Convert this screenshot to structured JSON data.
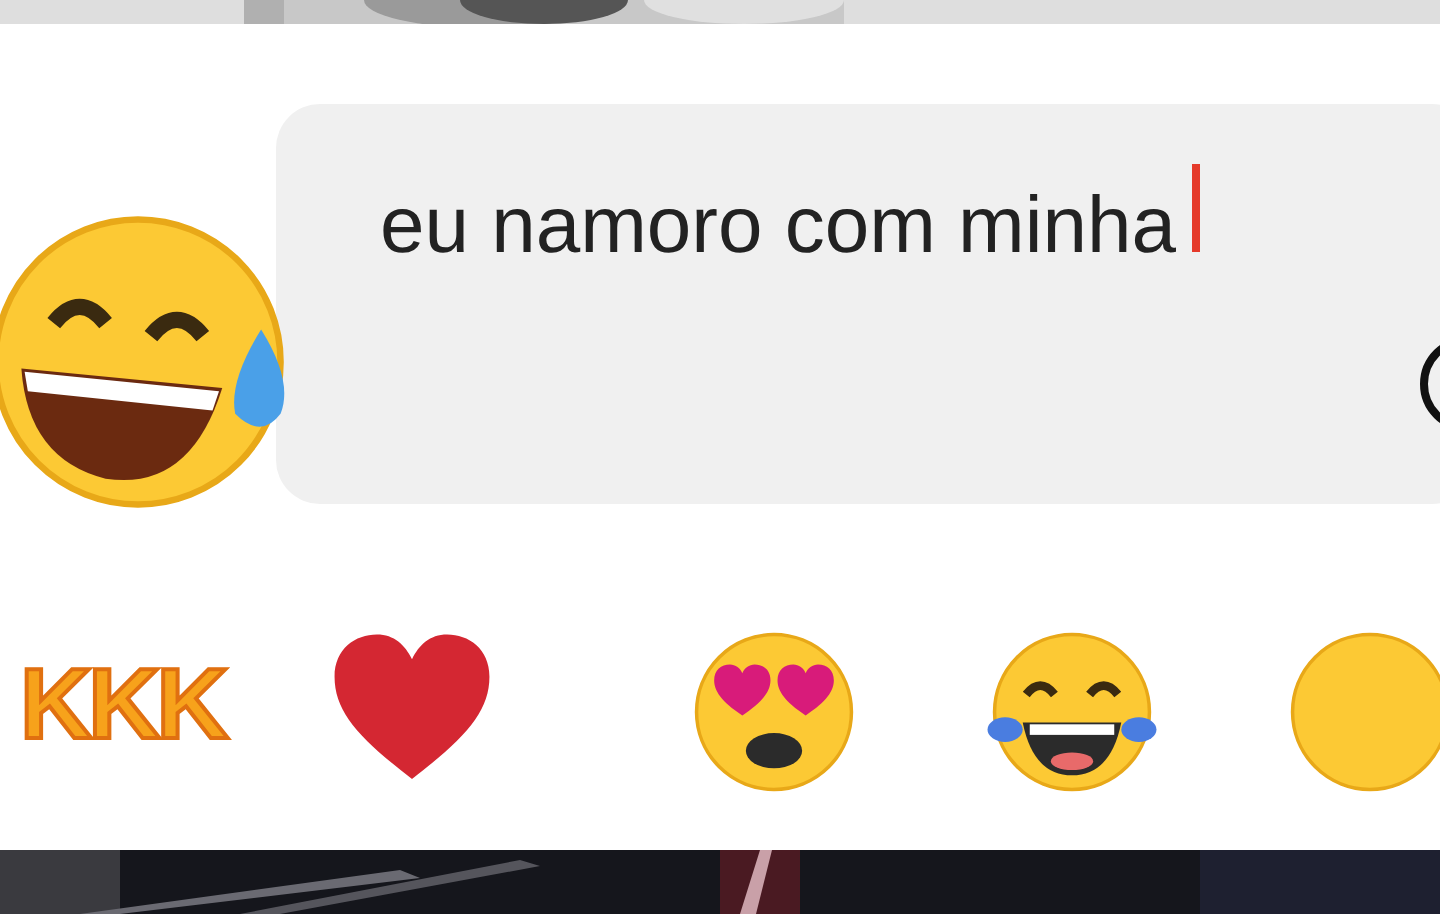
{
  "message_field": {
    "value": "eu namoro com minha",
    "focused": true
  },
  "reactions": [
    {
      "kind": "sticker",
      "text": "KKK"
    },
    {
      "kind": "heart"
    },
    {
      "kind": "heart-eyes"
    },
    {
      "kind": "tears-of-joy"
    },
    {
      "kind": "partial-face"
    }
  ]
}
